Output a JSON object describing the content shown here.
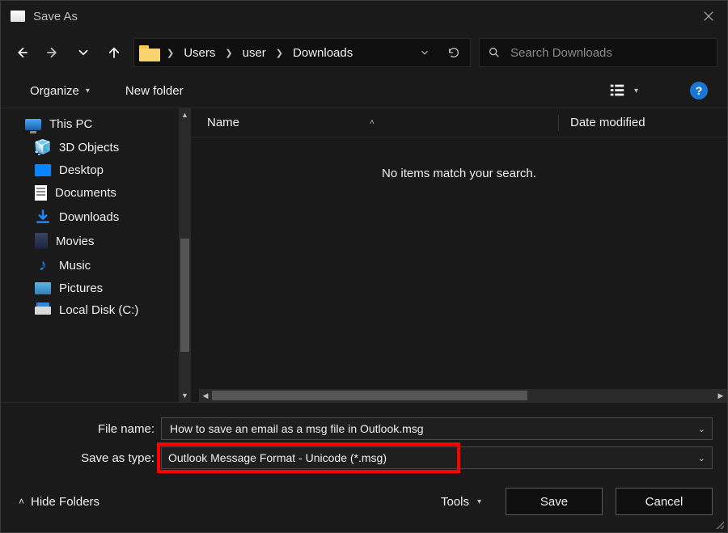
{
  "window": {
    "title": "Save As",
    "close_icon": "close"
  },
  "nav": {
    "crumbs": [
      "Users",
      "user",
      "Downloads"
    ]
  },
  "search": {
    "placeholder": "Search Downloads"
  },
  "toolbar": {
    "organize": "Organize",
    "new_folder": "New folder"
  },
  "sidebar": {
    "this_pc": "This PC",
    "items": [
      {
        "label": "3D Objects",
        "icon": "cube"
      },
      {
        "label": "Desktop",
        "icon": "desktop"
      },
      {
        "label": "Documents",
        "icon": "doc"
      },
      {
        "label": "Downloads",
        "icon": "dl"
      },
      {
        "label": "Movies",
        "icon": "mov"
      },
      {
        "label": "Music",
        "icon": "music"
      },
      {
        "label": "Pictures",
        "icon": "pic"
      },
      {
        "label": "Local Disk (C:)",
        "icon": "disk"
      }
    ]
  },
  "columns": {
    "name": "Name",
    "date": "Date modified"
  },
  "empty_message": "No items match your search.",
  "form": {
    "file_name_label": "File name:",
    "file_name_value": "How to save an email as a msg file in Outlook.msg",
    "save_type_label": "Save as type:",
    "save_type_value": "Outlook Message Format - Unicode (*.msg)"
  },
  "footer": {
    "hide_folders": "Hide Folders",
    "tools": "Tools",
    "save": "Save",
    "cancel": "Cancel"
  }
}
